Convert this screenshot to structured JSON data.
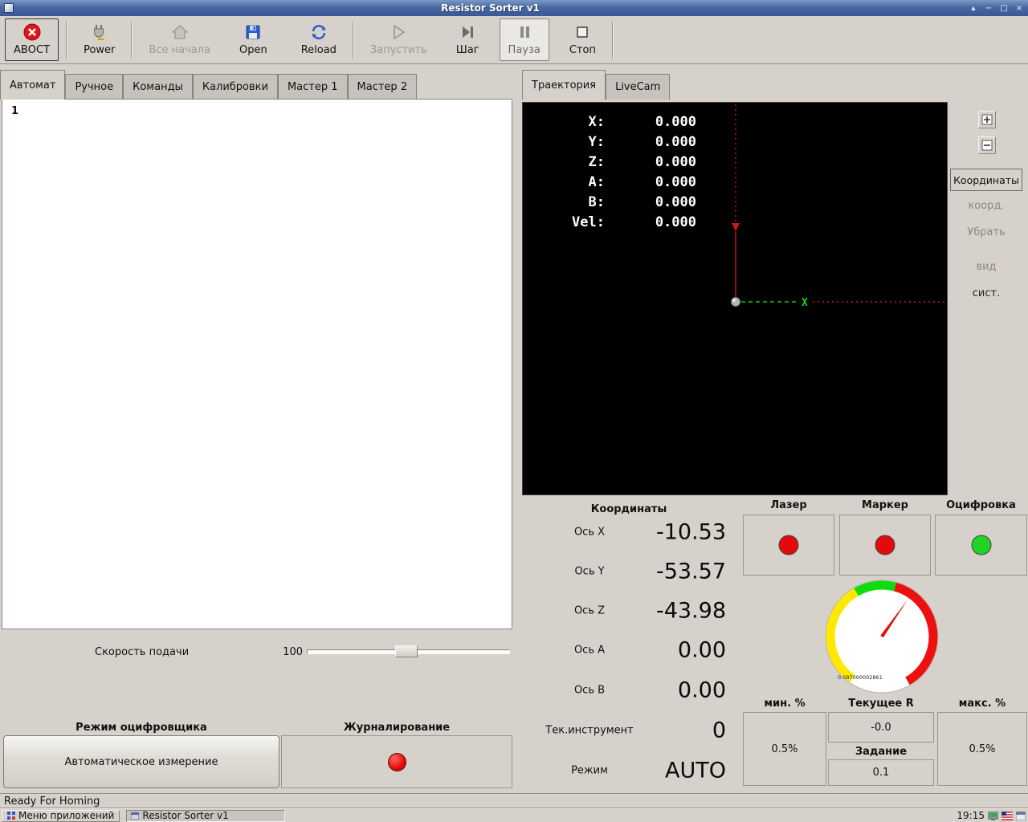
{
  "window": {
    "title": "Resistor Sorter v1",
    "controls": {
      "pin": "▴",
      "minimize": "−",
      "maximize": "□",
      "close": "×"
    }
  },
  "toolbar": {
    "estop_label": "АВОСТ",
    "power_label": "Power",
    "home_all_label": "Все начала",
    "open_label": "Open",
    "reload_label": "Reload",
    "run_label": "Запустить",
    "step_label": "Шаг",
    "pause_label": "Пауза",
    "stop_label": "Стоп"
  },
  "left_panel": {
    "tabs": [
      {
        "label": "Автомат"
      },
      {
        "label": "Ручное"
      },
      {
        "label": "Команды"
      },
      {
        "label": "Калибровки"
      },
      {
        "label": "Мастер 1"
      },
      {
        "label": "Мастер 2"
      }
    ],
    "gcode": {
      "first_line_number": "1"
    },
    "feed": {
      "label": "Скорость подачи",
      "value": "100"
    },
    "digitizer": {
      "title": "Режим оцифровщика",
      "button_label": "Автоматическое измерение"
    },
    "logging": {
      "title": "Журналирование"
    }
  },
  "right_panel": {
    "tabs": [
      {
        "label": "Траектория"
      },
      {
        "label": "LiveCam"
      }
    ],
    "preview": {
      "readout": [
        {
          "label": "X:",
          "value": "0.000"
        },
        {
          "label": "Y:",
          "value": "0.000"
        },
        {
          "label": "Z:",
          "value": "0.000"
        },
        {
          "label": "A:",
          "value": "0.000"
        },
        {
          "label": "B:",
          "value": "0.000"
        },
        {
          "label": "Vel:",
          "value": "0.000"
        }
      ],
      "x_axis_label": "X"
    },
    "view_controls": {
      "coordinates_button": "Координаты",
      "coord_label": "коорд.",
      "remove_label": "Убрать",
      "view_label": "вид",
      "system_label": "сист."
    }
  },
  "dro": {
    "title": "Координаты",
    "rows": [
      {
        "label": "Ось X",
        "value": "-10.53"
      },
      {
        "label": "Ось Y",
        "value": "-53.57"
      },
      {
        "label": "Ось Z",
        "value": "-43.98"
      },
      {
        "label": "Ось A",
        "value": "0.00"
      },
      {
        "label": "Ось B",
        "value": "0.00"
      },
      {
        "label": "Тек.инструмент",
        "value": "0"
      },
      {
        "label": "Режим",
        "value": "AUTO"
      }
    ]
  },
  "indicators": [
    {
      "label": "Лазер",
      "color": "#e20a0a"
    },
    {
      "label": "Маркер",
      "color": "#e20a0a"
    },
    {
      "label": "Оцифровка",
      "color": "#23d223"
    }
  ],
  "gauge": {
    "value": "0.097000002861"
  },
  "params": {
    "min": {
      "label": "мин. %",
      "value": "0.5%"
    },
    "current": {
      "label": "Текущее R",
      "value": "-0.0"
    },
    "target": {
      "label": "Задание",
      "value": "0.1"
    },
    "max": {
      "label": "макс. %",
      "value": "0.5%"
    }
  },
  "status_bar": {
    "text": "Ready For Homing"
  },
  "taskbar": {
    "menu_button": "Меню приложений",
    "task_button": "Resistor Sorter v1",
    "clock": "19:15"
  }
}
